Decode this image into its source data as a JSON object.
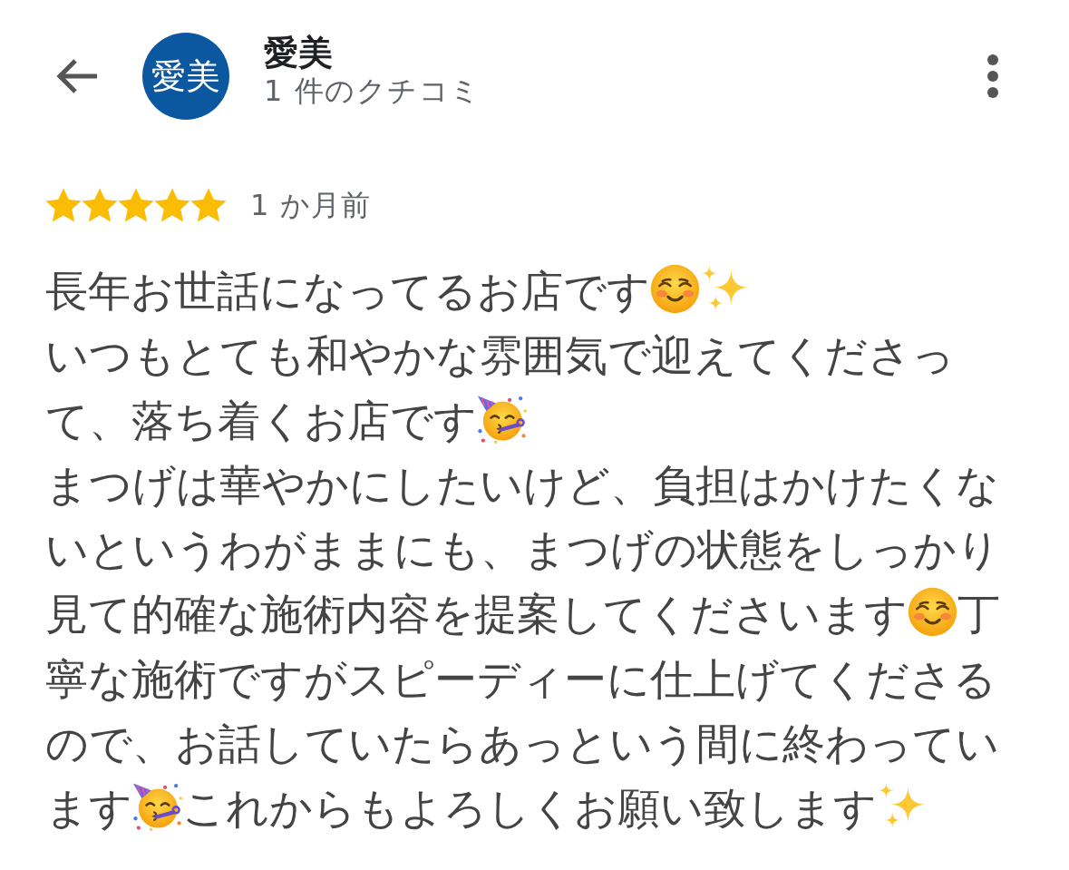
{
  "reviewer": {
    "avatar_text": "愛美",
    "name": "愛美",
    "review_count": "1 件のクチコミ"
  },
  "review": {
    "stars": 5,
    "time": "1 か月前",
    "lines": [
      [
        {
          "kind": "text",
          "text": "長年お世話になってるお店です"
        },
        {
          "kind": "smiling-face"
        },
        {
          "kind": "sparkles"
        }
      ],
      [
        {
          "kind": "text",
          "text": "いつもとても和やかな雰囲気で迎えてくださっ"
        }
      ],
      [
        {
          "kind": "text",
          "text": "て、落ち着くお店です"
        },
        {
          "kind": "party-face"
        }
      ],
      [
        {
          "kind": "text",
          "text": "まつげは華やかにしたいけど、負担はかけたくな"
        }
      ],
      [
        {
          "kind": "text",
          "text": "いというわがままにも、まつげの状態をしっかり"
        }
      ],
      [
        {
          "kind": "text",
          "text": "見て的確な施術内容を提案してくださいます"
        },
        {
          "kind": "smiling-face"
        },
        {
          "kind": "text",
          "text": "丁"
        }
      ],
      [
        {
          "kind": "text",
          "text": "寧な施術ですがスピーディーに仕上げてくださる"
        }
      ],
      [
        {
          "kind": "text",
          "text": "ので、お話していたらあっという間に終わってい"
        }
      ],
      [
        {
          "kind": "text",
          "text": "ます"
        },
        {
          "kind": "party-face"
        },
        {
          "kind": "text",
          "text": "これからもよろしくお願い致します"
        },
        {
          "kind": "sparkles"
        }
      ]
    ]
  }
}
